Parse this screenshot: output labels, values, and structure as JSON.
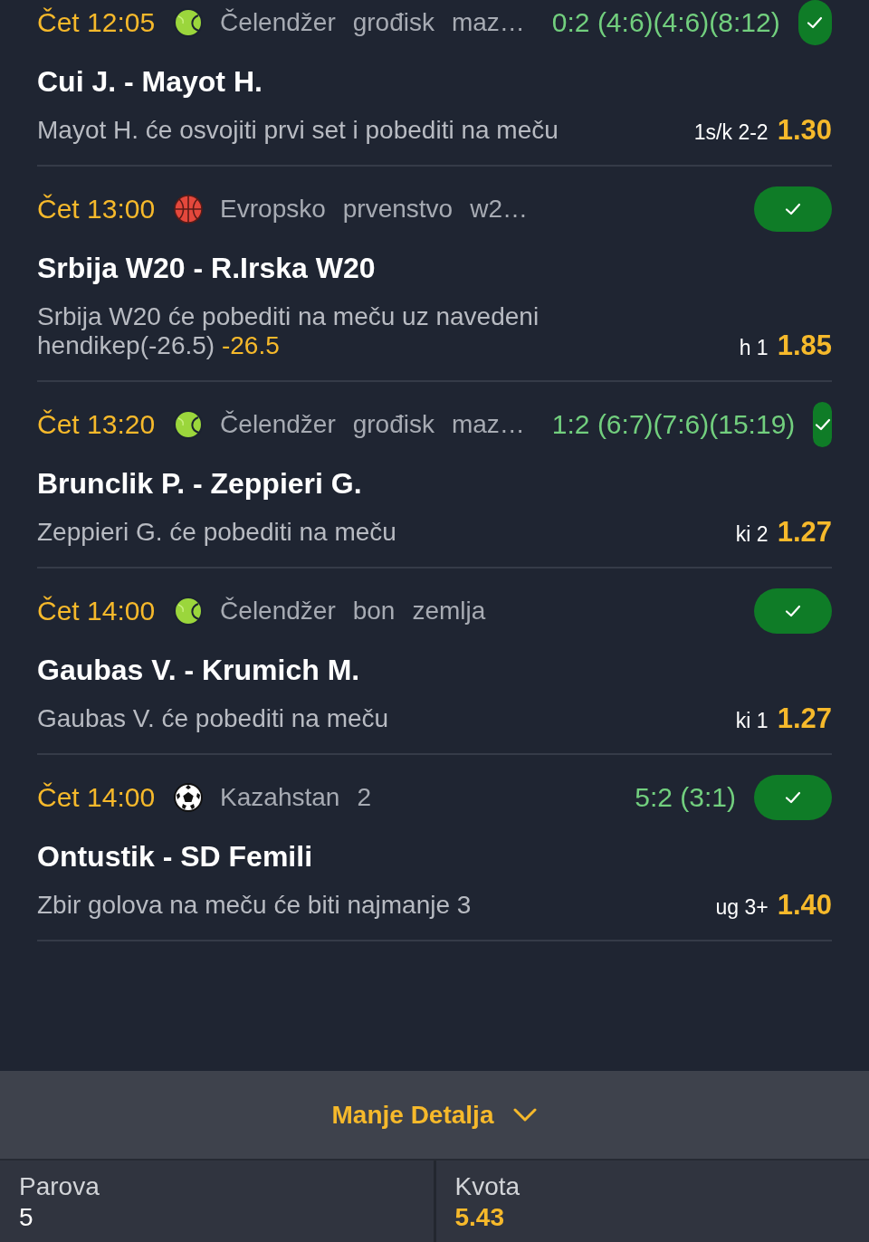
{
  "bets": [
    {
      "kind": "tennis",
      "time": "Čet 12:05",
      "league": "Čelendžer grođisk maz…",
      "score": "0:2 (4:6)(4:6)(8:12)",
      "won": true,
      "match": "Cui J. - Mayot H.",
      "pick": "Mayot H. će osvojiti prvi set i pobediti na meču",
      "market": "1s/k 2-2",
      "odds": "1.30"
    },
    {
      "kind": "basketball",
      "time": "Čet 13:00",
      "league": "Evropsko prvenstvo w2…",
      "won": true,
      "match": "Srbija W20 - R.Irska W20",
      "pick": "Srbija W20 će pobediti na meču uz navedeni hendikep(-26.5)",
      "handicap": "-26.5",
      "market": "h 1",
      "odds": "1.85"
    },
    {
      "kind": "tennis",
      "time": "Čet 13:20",
      "league": "Čelendžer grođisk maz…",
      "score": "1:2 (6:7)(7:6)(15:19)",
      "won": true,
      "match": "Brunclik P. - Zeppieri G.",
      "pick": "Zeppieri G. će pobediti na meču",
      "market": "ki 2",
      "odds": "1.27"
    },
    {
      "kind": "tennis",
      "time": "Čet 14:00",
      "league": "Čelendžer bon zemlja",
      "won": true,
      "match": "Gaubas V. - Krumich M.",
      "pick": "Gaubas V. će pobediti na meču",
      "market": "ki 1",
      "odds": "1.27"
    },
    {
      "kind": "soccer",
      "time": "Čet 14:00",
      "league": "Kazahstan 2",
      "score": "5:2 (3:1)",
      "won": true,
      "match": "Ontustik - SD Femili",
      "pick": "Zbir golova na meču će biti najmanje 3",
      "market": "ug 3+",
      "odds": "1.40"
    }
  ],
  "toggle": {
    "label": "Manje Detalja",
    "expanded": true
  },
  "summary": [
    {
      "kind": "count",
      "label": "Parova",
      "value": "5"
    },
    {
      "kind": "odds",
      "label": "Kvota",
      "value": "5.43"
    }
  ]
}
